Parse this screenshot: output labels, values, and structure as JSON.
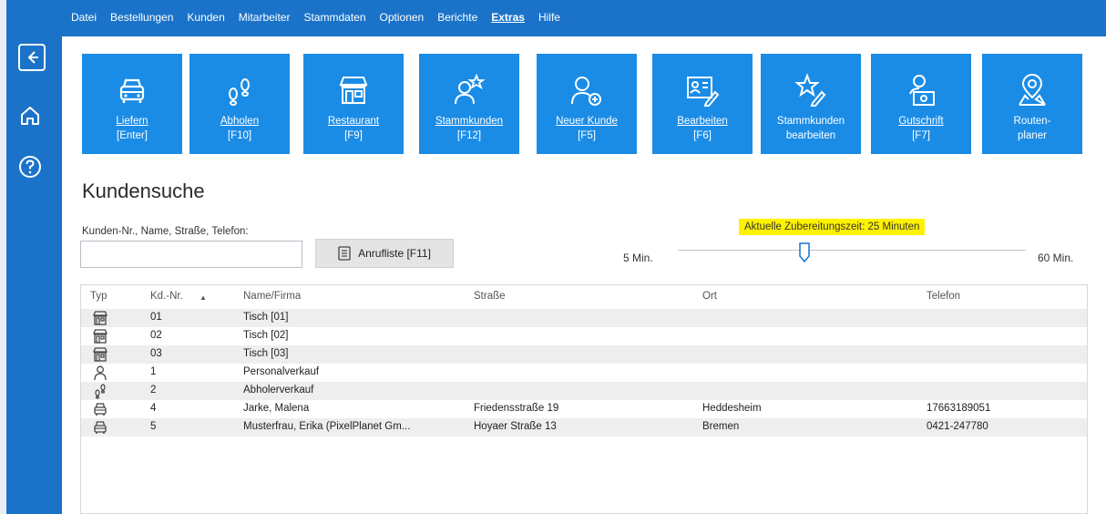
{
  "menu": {
    "items": [
      "Datei",
      "Bestellungen",
      "Kunden",
      "Mitarbeiter",
      "Stammdaten",
      "Optionen",
      "Berichte",
      "Extras",
      "Hilfe"
    ],
    "active": "Extras"
  },
  "rail": {
    "icons": [
      "back-icon",
      "home-icon",
      "help-icon"
    ]
  },
  "ribbon": {
    "tiles": [
      {
        "line1": "Liefern",
        "line2": "[Enter]",
        "icon": "car-icon"
      },
      {
        "line1": "Abholen",
        "line2": "[F10]",
        "icon": "footprints-icon"
      },
      {
        "line1": "Restaurant",
        "line2": "[F9]",
        "icon": "restaurant-icon"
      },
      {
        "line1": "Stammkunden",
        "line2": "[F12]",
        "icon": "regular-customer-icon"
      },
      {
        "line1": "Neuer Kunde",
        "line2": "[F5]",
        "icon": "add-customer-icon"
      },
      {
        "line1": "Bearbeiten",
        "line2": "[F6]",
        "icon": "edit-card-icon"
      },
      {
        "line1": "Stammkunden",
        "line2": "bearbeiten",
        "icon": "edit-star-icon"
      },
      {
        "line1": "Gutschrift",
        "line2": "[F7]",
        "icon": "voucher-icon"
      },
      {
        "line1": "Routen-",
        "line2": "planer",
        "icon": "route-icon"
      }
    ]
  },
  "search": {
    "title": "Kundensuche",
    "label": "Kunden-Nr., Name, Straße, Telefon:",
    "value": "",
    "calllist_button": "Anrufliste [F11]"
  },
  "prep_time": {
    "label": "Aktuelle Zubereitungszeit: 25 Minuten",
    "min_label": "5 Min.",
    "max_label": "60 Min.",
    "min": 5,
    "max": 60,
    "value": 25
  },
  "table": {
    "columns": [
      "Typ",
      "Kd.-Nr.",
      "Name/Firma",
      "Straße",
      "Ort",
      "Telefon"
    ],
    "sort_indicator": "▲",
    "rows": [
      {
        "type": "restaurant",
        "kd": "01",
        "name": "Tisch [01]",
        "street": "",
        "city": "",
        "phone": ""
      },
      {
        "type": "restaurant",
        "kd": "02",
        "name": "Tisch [02]",
        "street": "",
        "city": "",
        "phone": ""
      },
      {
        "type": "restaurant",
        "kd": "03",
        "name": "Tisch [03]",
        "street": "",
        "city": "",
        "phone": ""
      },
      {
        "type": "person",
        "kd": "1",
        "name": "Personalverkauf",
        "street": "",
        "city": "",
        "phone": ""
      },
      {
        "type": "pickup",
        "kd": "2",
        "name": "Abholerverkauf",
        "street": "",
        "city": "",
        "phone": ""
      },
      {
        "type": "delivery",
        "kd": "4",
        "name": "Jarke, Malena",
        "street": "Friedensstraße 19",
        "city": "Heddesheim",
        "phone": "17663189051"
      },
      {
        "type": "delivery",
        "kd": "5",
        "name": "Musterfrau, Erika (PixelPlanet Gm...",
        "street": "Hoyaer Straße 13",
        "city": "Bremen",
        "phone": "0421-247780"
      }
    ]
  }
}
